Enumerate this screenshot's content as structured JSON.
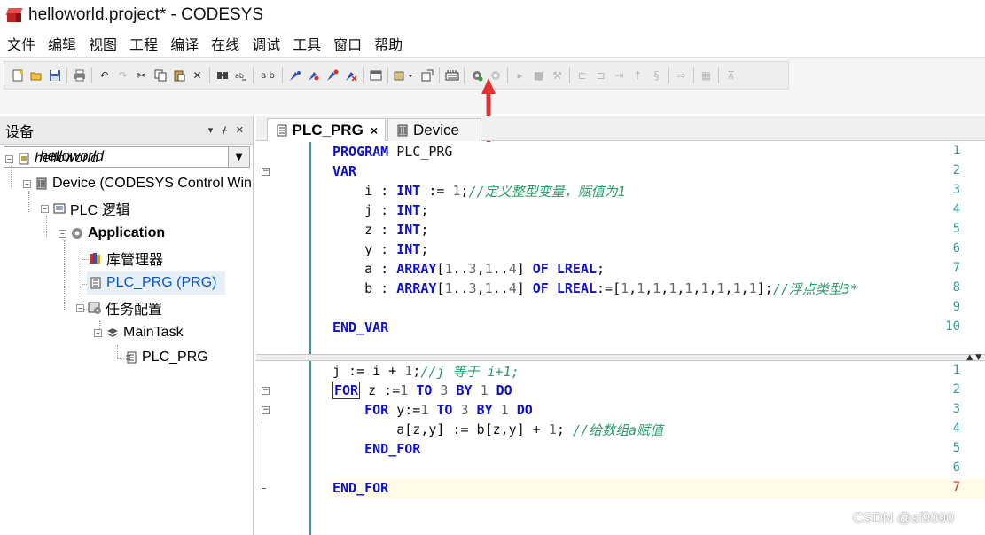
{
  "window": {
    "title": "helloworld.project* - CODESYS"
  },
  "menu": [
    "文件",
    "编辑",
    "视图",
    "工程",
    "编译",
    "在线",
    "调试",
    "工具",
    "窗口",
    "帮助"
  ],
  "toolbar": {
    "buttons": [
      "new-icon",
      "open-icon",
      "save-icon",
      "print-icon",
      "undo-icon",
      "redo-icon",
      "cut-icon",
      "copy-icon",
      "paste-icon",
      "delete-icon",
      "find-icon",
      "replace-icon",
      "ab-icon",
      "bookmark-icon",
      "bookmark-next-icon",
      "bookmark-prev-icon",
      "bookmark-clear-icon",
      "window-icon",
      "add-object-icon",
      "export-icon",
      "build-icon",
      "login-icon",
      "logout-icon",
      "start-icon",
      "stop-icon",
      "reset-icon",
      "step-over-icon",
      "step-into-icon",
      "step-out-icon",
      "set-next-icon",
      "show-next-icon",
      "write-icon",
      "force-icon",
      "cart-icon"
    ],
    "ab_label": "a·b"
  },
  "devices": {
    "title": "设备",
    "pin_label": "▾ ⊥ ✕",
    "combo_value": "helloworld",
    "tree": [
      {
        "label": "helloworld",
        "style": "italic"
      },
      {
        "label": "Device (CODESYS Control Win"
      },
      {
        "label": "PLC 逻辑"
      },
      {
        "label": "Application",
        "style": "bold"
      },
      {
        "label": "库管理器"
      },
      {
        "label": "PLC_PRG (PRG)",
        "selected": true
      },
      {
        "label": "任务配置"
      },
      {
        "label": "MainTask"
      },
      {
        "label": "PLC_PRG"
      }
    ]
  },
  "tabs": [
    {
      "label": "PLC_PRG",
      "active": true,
      "close": "×"
    },
    {
      "label": "Device",
      "active": false
    }
  ],
  "declaration": {
    "line_numbers": [
      "1",
      "2",
      "3",
      "4",
      "5",
      "6",
      "7",
      "8",
      "9",
      "10"
    ],
    "lines": [
      [
        [
          "kw",
          "PROGRAM"
        ],
        [
          "id",
          " PLC_PRG"
        ]
      ],
      [
        [
          "kw",
          "VAR"
        ]
      ],
      [
        [
          "id",
          "    i : "
        ],
        [
          "kw",
          "INT"
        ],
        [
          "op",
          " := "
        ],
        [
          "num",
          "1"
        ],
        [
          "op",
          ";"
        ],
        [
          "cmt",
          "//定义整型变量，赋值为1"
        ]
      ],
      [
        [
          "id",
          "    j : "
        ],
        [
          "kw",
          "INT"
        ],
        [
          "op",
          ";"
        ]
      ],
      [
        [
          "id",
          "    z : "
        ],
        [
          "kw",
          "INT"
        ],
        [
          "op",
          ";"
        ]
      ],
      [
        [
          "id",
          "    y : "
        ],
        [
          "kw",
          "INT"
        ],
        [
          "op",
          ";"
        ]
      ],
      [
        [
          "id",
          "    a : "
        ],
        [
          "kw",
          "ARRAY"
        ],
        [
          "op",
          "["
        ],
        [
          "num",
          "1"
        ],
        [
          "op",
          ".."
        ],
        [
          "num",
          "3"
        ],
        [
          "op",
          ","
        ],
        [
          "num",
          "1"
        ],
        [
          "op",
          ".."
        ],
        [
          "num",
          "4"
        ],
        [
          "op",
          "] "
        ],
        [
          "kw",
          "OF"
        ],
        [
          "op",
          " "
        ],
        [
          "kw",
          "LREAL"
        ],
        [
          "op",
          ";"
        ]
      ],
      [
        [
          "id",
          "    b : "
        ],
        [
          "kw",
          "ARRAY"
        ],
        [
          "op",
          "["
        ],
        [
          "num",
          "1"
        ],
        [
          "op",
          ".."
        ],
        [
          "num",
          "3"
        ],
        [
          "op",
          ","
        ],
        [
          "num",
          "1"
        ],
        [
          "op",
          ".."
        ],
        [
          "num",
          "4"
        ],
        [
          "op",
          "] "
        ],
        [
          "kw",
          "OF"
        ],
        [
          "op",
          " "
        ],
        [
          "kw",
          "LREAL"
        ],
        [
          "op",
          ":=["
        ],
        [
          "num",
          "1"
        ],
        [
          "op",
          ","
        ],
        [
          "num",
          "1"
        ],
        [
          "op",
          ","
        ],
        [
          "num",
          "1"
        ],
        [
          "op",
          ","
        ],
        [
          "num",
          "1"
        ],
        [
          "op",
          ","
        ],
        [
          "num",
          "1"
        ],
        [
          "op",
          ","
        ],
        [
          "num",
          "1"
        ],
        [
          "op",
          ","
        ],
        [
          "num",
          "1"
        ],
        [
          "op",
          ","
        ],
        [
          "num",
          "1"
        ],
        [
          "op",
          ","
        ],
        [
          "num",
          "1"
        ],
        [
          "op",
          "];"
        ],
        [
          "cmt",
          "//浮点类型3*"
        ]
      ],
      [
        [
          "id",
          ""
        ]
      ],
      [
        [
          "kw",
          "END_VAR"
        ]
      ]
    ]
  },
  "implementation": {
    "line_numbers": [
      "1",
      "2",
      "3",
      "4",
      "5",
      "6",
      "7"
    ],
    "lines": [
      [
        [
          "id",
          "j := i + "
        ],
        [
          "num",
          "1"
        ],
        [
          "op",
          ";"
        ],
        [
          "cmt",
          "//j 等于 i+1;"
        ]
      ],
      [
        [
          "kw",
          "FOR"
        ],
        [
          "id",
          " z :="
        ],
        [
          "num",
          "1"
        ],
        [
          "op",
          " "
        ],
        [
          "kw",
          "TO"
        ],
        [
          "op",
          " "
        ],
        [
          "num",
          "3"
        ],
        [
          "op",
          " "
        ],
        [
          "kw",
          "BY"
        ],
        [
          "op",
          " "
        ],
        [
          "num",
          "1"
        ],
        [
          "op",
          " "
        ],
        [
          "kw",
          "DO"
        ]
      ],
      [
        [
          "id",
          "    "
        ],
        [
          "kw",
          "FOR"
        ],
        [
          "id",
          " y:="
        ],
        [
          "num",
          "1"
        ],
        [
          "op",
          " "
        ],
        [
          "kw",
          "TO"
        ],
        [
          "op",
          " "
        ],
        [
          "num",
          "3"
        ],
        [
          "op",
          " "
        ],
        [
          "kw",
          "BY"
        ],
        [
          "op",
          " "
        ],
        [
          "num",
          "1"
        ],
        [
          "op",
          " "
        ],
        [
          "kw",
          "DO"
        ]
      ],
      [
        [
          "id",
          "        a[z,y] := b[z,y] + "
        ],
        [
          "num",
          "1"
        ],
        [
          "op",
          "; "
        ],
        [
          "cmt",
          "//给数组a赋值"
        ]
      ],
      [
        [
          "id",
          "    "
        ],
        [
          "kw",
          "END_FOR"
        ]
      ],
      [
        [
          "id",
          ""
        ]
      ],
      [
        [
          "kw",
          "END_FOR"
        ]
      ]
    ]
  },
  "watermark": "CSDN @sf9090",
  "colors": {
    "keyword": "#1010c8",
    "comment": "#2a9a6a",
    "line_number": "#3a9a9a",
    "annotation_arrow": "#e53030"
  }
}
